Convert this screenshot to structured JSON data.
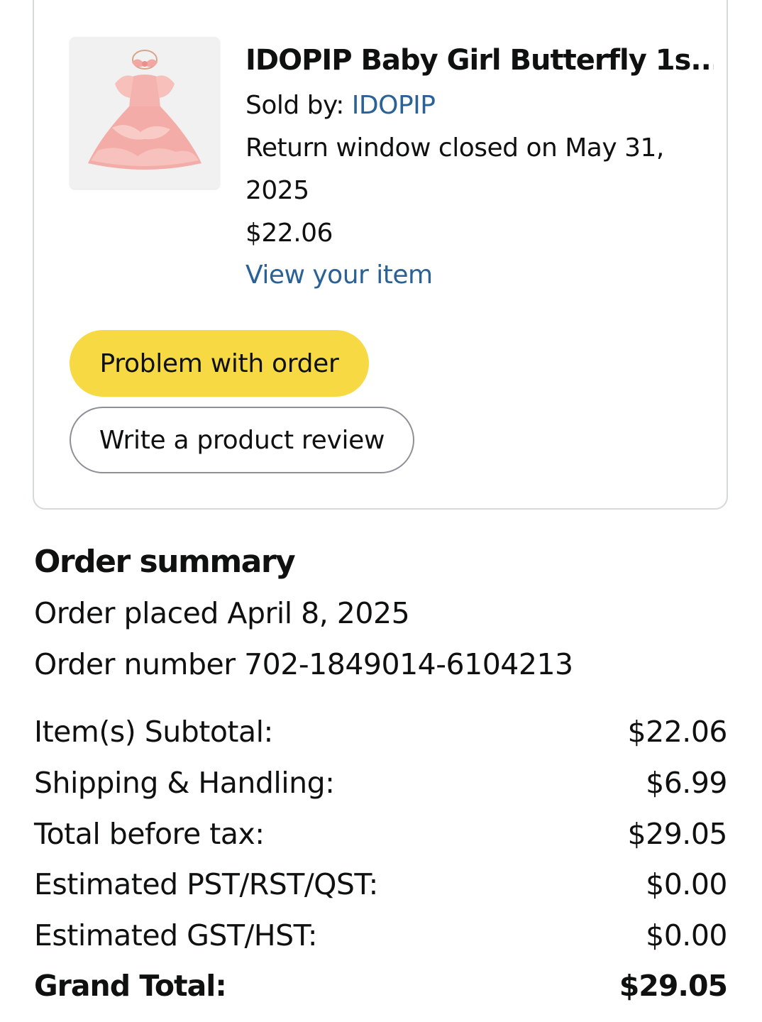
{
  "item": {
    "title": "IDOPIP Baby Girl Butterfly 1s...",
    "sold_by_label": "Sold by:",
    "seller": "IDOPIP",
    "return_line1": "Return window closed on May 31,",
    "return_line2": "2025",
    "price": "$22.06",
    "view_link": "View your item",
    "problem_button": "Problem with order",
    "review_button": "Write a product review"
  },
  "summary": {
    "title": "Order summary",
    "placed": "Order placed April 8, 2025",
    "number": "Order number 702-1849014-6104213",
    "rows": [
      {
        "label": "Item(s) Subtotal:",
        "value": "$22.06"
      },
      {
        "label": "Shipping & Handling:",
        "value": "$6.99"
      },
      {
        "label": "Total before tax:",
        "value": "$29.05"
      },
      {
        "label": "Estimated PST/RST/QST:",
        "value": "$0.00"
      },
      {
        "label": "Estimated GST/HST:",
        "value": "$0.00"
      },
      {
        "label": "Grand Total:",
        "value": "$29.05"
      }
    ]
  },
  "colors": {
    "link": "#2a6196",
    "primary_button": "#f7d943"
  }
}
